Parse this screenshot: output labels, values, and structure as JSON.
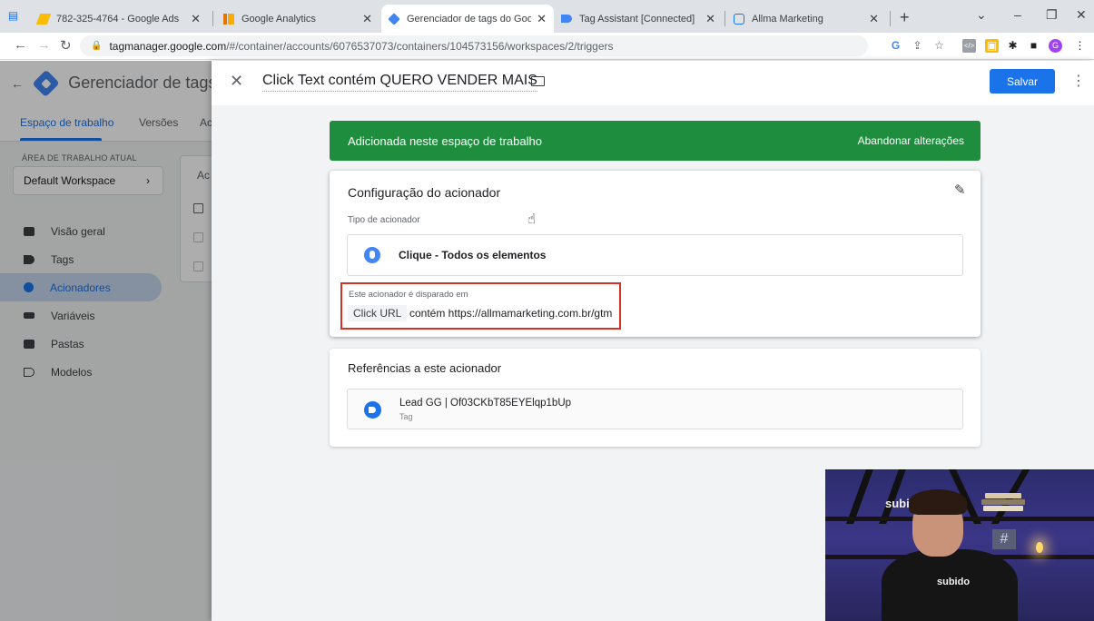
{
  "browser": {
    "tabs": [
      {
        "title": "782-325-4764 - Google Ads",
        "icon": "google-ads-icon",
        "color": "#fbbc04"
      },
      {
        "title": "Google Analytics",
        "icon": "google-analytics-icon",
        "color": "#f9ab00"
      },
      {
        "title": "Gerenciador de tags do Google",
        "icon": "gtm-icon",
        "color": "#4285f4",
        "active": true
      },
      {
        "title": "Tag Assistant [Connected]",
        "icon": "tag-assistant-icon",
        "color": "#4285f4"
      },
      {
        "title": "Allma Marketing",
        "icon": "allma-icon",
        "color": "#1a73e8"
      }
    ],
    "url_host": "tagmanager.google.com",
    "url_path": "/#/container/accounts/6076537073/containers/104573156/workspaces/2/triggers",
    "profile_initial": "G"
  },
  "app": {
    "name": "Gerenciador de tags",
    "tabs": {
      "workspace": "Espaço de trabalho",
      "versions": "Versões",
      "admin": "Ac"
    },
    "workspace_label": "ÁREA DE TRABALHO ATUAL",
    "workspace_name": "Default Workspace",
    "nav": [
      {
        "label": "Visão geral",
        "icon": "folder-icon"
      },
      {
        "label": "Tags",
        "icon": "tag-icon"
      },
      {
        "label": "Acionadores",
        "icon": "trigger-icon",
        "selected": true
      },
      {
        "label": "Variáveis",
        "icon": "variables-icon"
      },
      {
        "label": "Pastas",
        "icon": "folder-icon"
      },
      {
        "label": "Modelos",
        "icon": "template-icon"
      }
    ],
    "bg_card_label": "Ac"
  },
  "panel": {
    "title": "Click Text contém QUERO VENDER MAIS",
    "save_label": "Salvar",
    "banner": {
      "text": "Adicionada neste espaço de trabalho",
      "discard": "Abandonar alterações",
      "color": "#1e8e3e"
    },
    "config": {
      "title": "Configuração do acionador",
      "type_label": "Tipo de acionador",
      "type_name": "Clique - Todos os elementos",
      "fires_label": "Este acionador é disparado em",
      "variable": "Click URL",
      "condition": "contém https://allmamarketing.com.br/gtm"
    },
    "references": {
      "title": "Referências a este acionador",
      "items": [
        {
          "name": "Lead GG | Of03CKbT85EYElqp1bUp",
          "type": "Tag"
        }
      ]
    }
  },
  "webcam": {
    "sign_top": "subid",
    "shirt": "subido"
  }
}
